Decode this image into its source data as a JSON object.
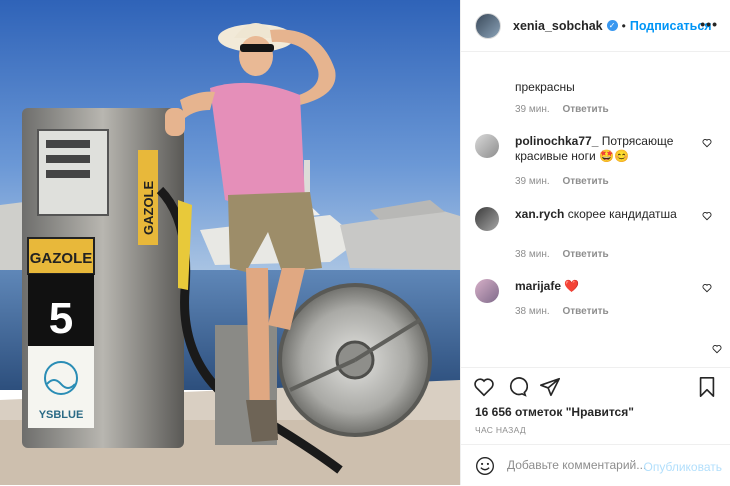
{
  "header": {
    "username": "xenia_sobchak",
    "separator": "•",
    "follow_label": "Подписаться",
    "more_icon": "more-horizontal-icon"
  },
  "comments": {
    "continued": {
      "text": "прекрасны",
      "time": "39 мин.",
      "reply": "Ответить"
    },
    "items": [
      {
        "username": "polinochka77_",
        "text": "Потрясающе красивые ноги 🤩😊",
        "time": "39 мин.",
        "reply": "Ответить"
      },
      {
        "username": "xan.rych",
        "text": "скорее кандидатша",
        "time": "38 мин.",
        "reply": "Ответить"
      },
      {
        "username": "marijafe",
        "text": "❤️",
        "time": "38 мин.",
        "reply": "Ответить"
      }
    ]
  },
  "actions": {
    "like_icon": "heart-icon",
    "comment_icon": "comment-icon",
    "share_icon": "send-icon",
    "save_icon": "bookmark-icon",
    "likes": "16 656 отметок \"Нравится\"",
    "time": "ЧАС НАЗАД"
  },
  "add_comment": {
    "placeholder": "Добавьте комментарий...",
    "publish_label": "Опубликовать",
    "emoji_icon": "smile-icon"
  },
  "photo": {
    "pump_label": "GAZOLE",
    "pump_label_side": "GAZOLE",
    "pump_number": "5",
    "brand": "YSBLUE"
  },
  "colors": {
    "accent": "#0095f6",
    "publish_disabled": "#b2dffc",
    "sky": "#3f74c4",
    "pump_yellow": "#e8b83a",
    "shirt_pink": "#e58fb9"
  }
}
